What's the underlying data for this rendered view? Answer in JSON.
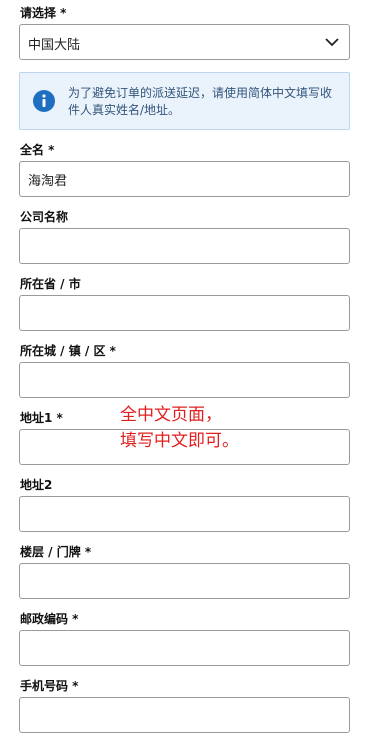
{
  "country_select": {
    "label": "请选择 *",
    "value": "中国大陆"
  },
  "notice": {
    "text": "为了避免订单的派送延迟，请使用简体中文填写收件人真实姓名/地址。"
  },
  "fields": {
    "full_name": {
      "label": "全名 *",
      "value": "海淘君"
    },
    "company": {
      "label": "公司名称",
      "value": ""
    },
    "province": {
      "label": "所在省 / 市",
      "value": ""
    },
    "city": {
      "label": "所在城 / 镇 / 区 *",
      "value": ""
    },
    "address1": {
      "label": "地址1 *",
      "value": ""
    },
    "address2": {
      "label": "地址2",
      "value": ""
    },
    "floor": {
      "label": "楼层 / 门牌 *",
      "value": ""
    },
    "postcode": {
      "label": "邮政编码 *",
      "value": ""
    },
    "phone": {
      "label": "手机号码 *",
      "value": ""
    }
  },
  "annotation": {
    "line1": "全中文页面，",
    "line2": "填写中文即可。"
  },
  "colors": {
    "annotation": "#e02020",
    "notice_bg": "#eaf3fc",
    "info_icon": "#1e6fc0"
  }
}
